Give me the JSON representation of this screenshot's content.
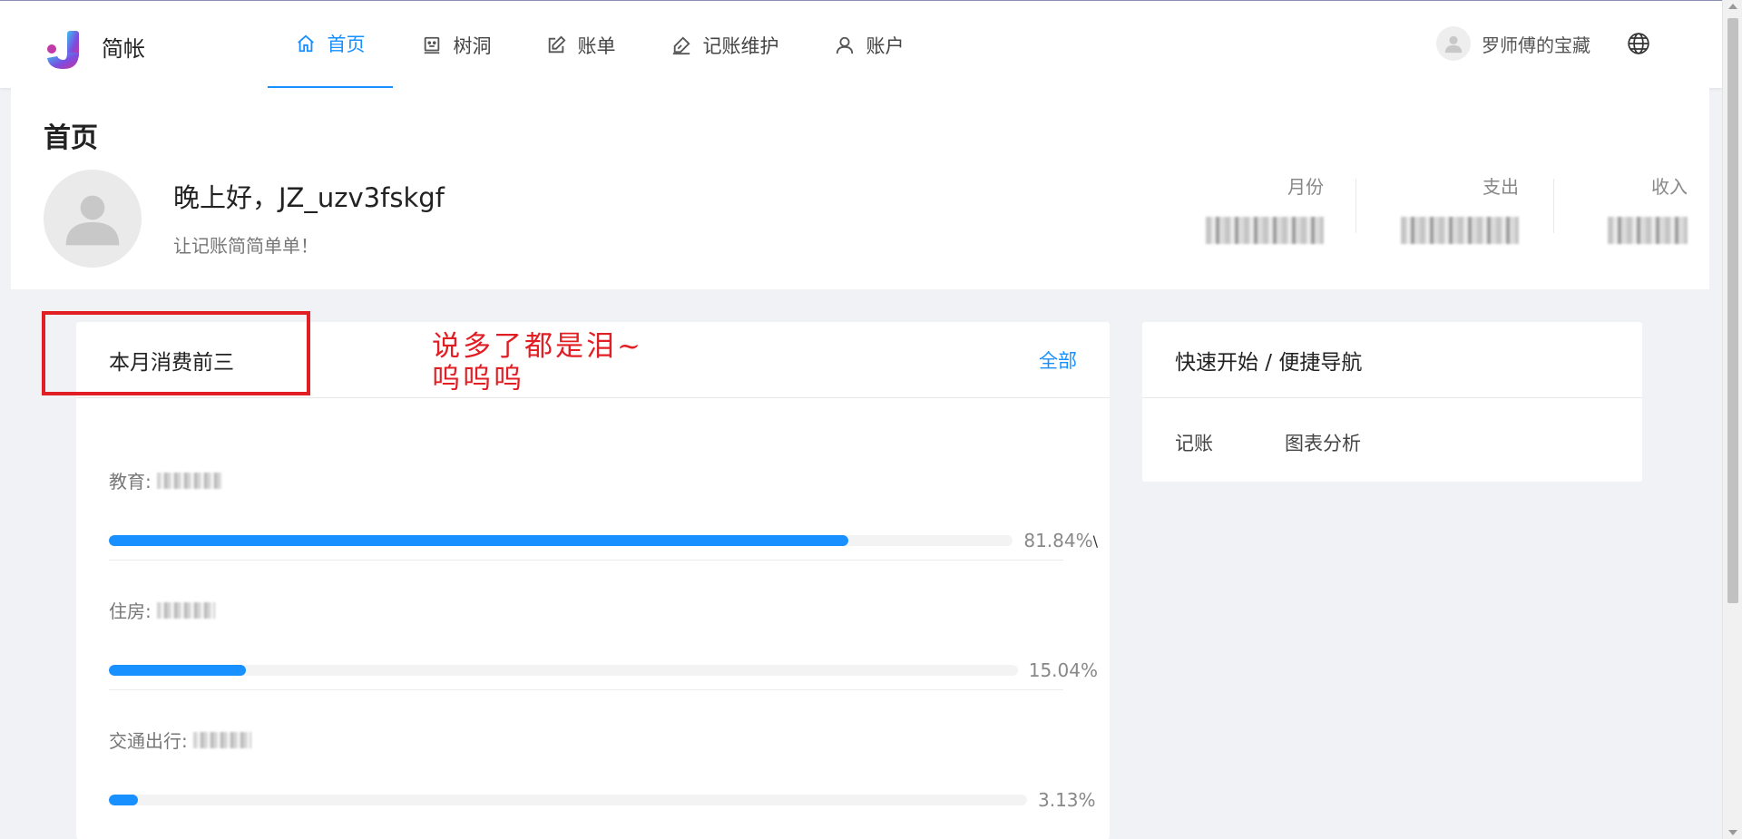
{
  "app": {
    "brand": "简帐"
  },
  "colors": {
    "accent": "#1890ff",
    "annotation": "#e01e24"
  },
  "nav": {
    "items": [
      {
        "label": "首页",
        "icon": "home-icon",
        "active": true
      },
      {
        "label": "树洞",
        "icon": "face-icon",
        "active": false
      },
      {
        "label": "账单",
        "icon": "edit-icon",
        "active": false
      },
      {
        "label": "记账维护",
        "icon": "pen-icon",
        "active": false
      },
      {
        "label": "账户",
        "icon": "user-icon",
        "active": false
      }
    ]
  },
  "user": {
    "name": "罗师傅的宝藏",
    "avatar_icon": "user-avatar-icon",
    "language_icon": "globe-icon"
  },
  "header": {
    "page_title": "首页",
    "greeting": "晚上好，JZ_uzv3fskgf",
    "sub_greeting": "让记账简简单单！",
    "stats": [
      {
        "label": "月份"
      },
      {
        "label": "支出"
      },
      {
        "label": "收入"
      }
    ]
  },
  "top_spending": {
    "title": "本月消费前三",
    "extra_link": "全部",
    "items": [
      {
        "category": "教育:",
        "percent_label": "81.84%",
        "percent": 81.84
      },
      {
        "category": "住房:",
        "percent_label": "15.04%",
        "percent": 15.04
      },
      {
        "category": "交通出行:",
        "percent_label": "3.13%",
        "percent": 3.13
      }
    ]
  },
  "quick_nav": {
    "title": "快速开始 / 便捷导航",
    "links": [
      "记账",
      "图表分析"
    ]
  },
  "annotation": {
    "line1": "说多了都是泪~",
    "line2": "呜呜呜"
  }
}
